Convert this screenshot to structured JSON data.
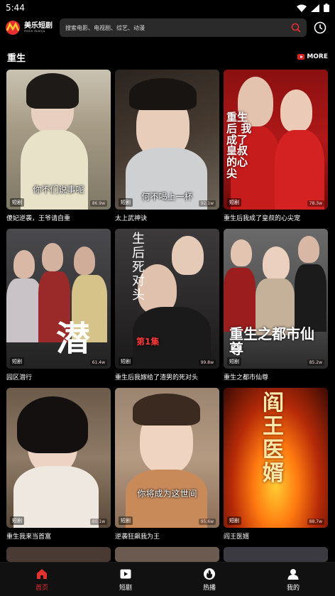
{
  "status_bar": {
    "time": "5:44"
  },
  "header": {
    "logo_text": "美乐短剧",
    "logo_subtext": "meile duanju",
    "search_placeholder": "搜索电影、电视剧、综艺、动漫"
  },
  "section": {
    "title": "重生",
    "more_label": "MORE"
  },
  "cards": [
    {
      "title": "傻妃逆袭，王爷请自重",
      "badge": "短剧",
      "playcount": "86.9w",
      "subtitle": "你不们说事呢"
    },
    {
      "title": "太上武神诀",
      "badge": "短剧",
      "playcount": "92.1w",
      "subtitle": "何不喝上一杯"
    },
    {
      "title": "重生后我成了皇叔的心尖宠",
      "badge": "短剧",
      "playcount": "78.3w",
      "subtitle": ""
    },
    {
      "title": "园区潜行",
      "badge": "短剧",
      "playcount": "61.4w",
      "subtitle": ""
    },
    {
      "title": "重生后我嫁给了渣男的死对头",
      "badge": "短剧",
      "playcount": "99.8w",
      "subtitle": "第1集"
    },
    {
      "title": "重生之都市仙尊",
      "badge": "短剧",
      "playcount": "85.2w",
      "subtitle": ""
    },
    {
      "title": "重生我来当首富",
      "badge": "短剧",
      "playcount": "80.1w",
      "subtitle": ""
    },
    {
      "title": "逆袭狂飙我为王",
      "badge": "短剧",
      "playcount": "95.6w",
      "subtitle": "你将成为这世间"
    },
    {
      "title": "阎王医婿",
      "badge": "短剧",
      "playcount": "88.7w",
      "subtitle": ""
    }
  ],
  "poster_texts": {
    "card3_vertical": "重生后 我成了皇叔的心尖",
    "card4_big": "潜",
    "card5_big": "生后 死对头",
    "card6_big": "重生之都市仙尊",
    "card9_big": "阎王医婿"
  },
  "bottom_nav": [
    {
      "label": "首页",
      "active": true
    },
    {
      "label": "短剧",
      "active": false
    },
    {
      "label": "热播",
      "active": false
    },
    {
      "label": "我的",
      "active": false
    }
  ],
  "colors": {
    "accent": "#e53030",
    "background": "#000000",
    "search_bg": "#2a2a2a"
  }
}
